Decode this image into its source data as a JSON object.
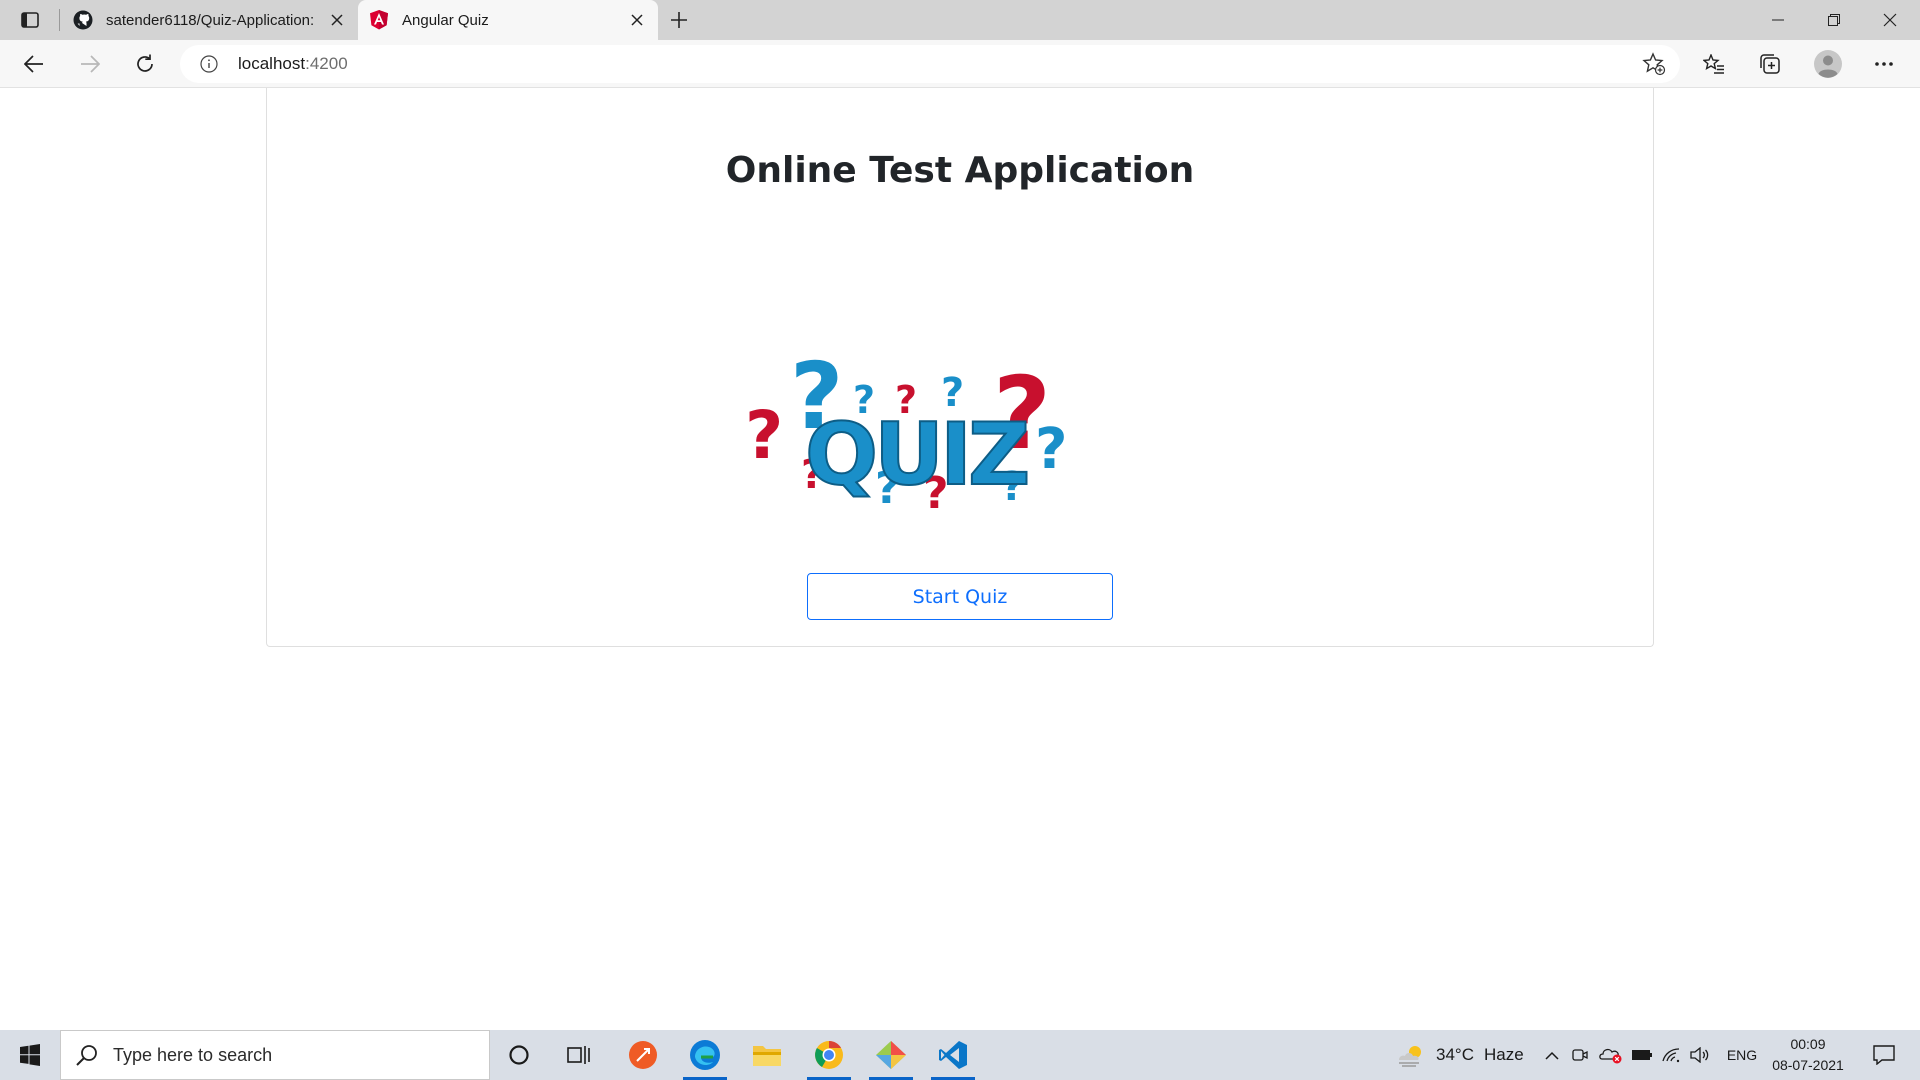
{
  "browser": {
    "tabs": [
      {
        "title": "satender6118/Quiz-Application:",
        "favicon": "github-icon",
        "active": false
      },
      {
        "title": "Angular Quiz",
        "favicon": "angular-icon",
        "active": true
      }
    ],
    "address": {
      "host": "localhost",
      "port": ":4200"
    }
  },
  "page": {
    "title": "Online Test Application",
    "logo_text": "QUIZ",
    "start_button": "Start Quiz"
  },
  "taskbar": {
    "search_placeholder": "Type here to search",
    "weather": {
      "temp": "34°C",
      "condition": "Haze"
    },
    "language": "ENG",
    "time": "00:09",
    "date": "08-07-2021"
  },
  "colors": {
    "accent": "#0d6efd",
    "quiz_blue": "#1a8fc9",
    "quiz_red": "#c8102e"
  }
}
